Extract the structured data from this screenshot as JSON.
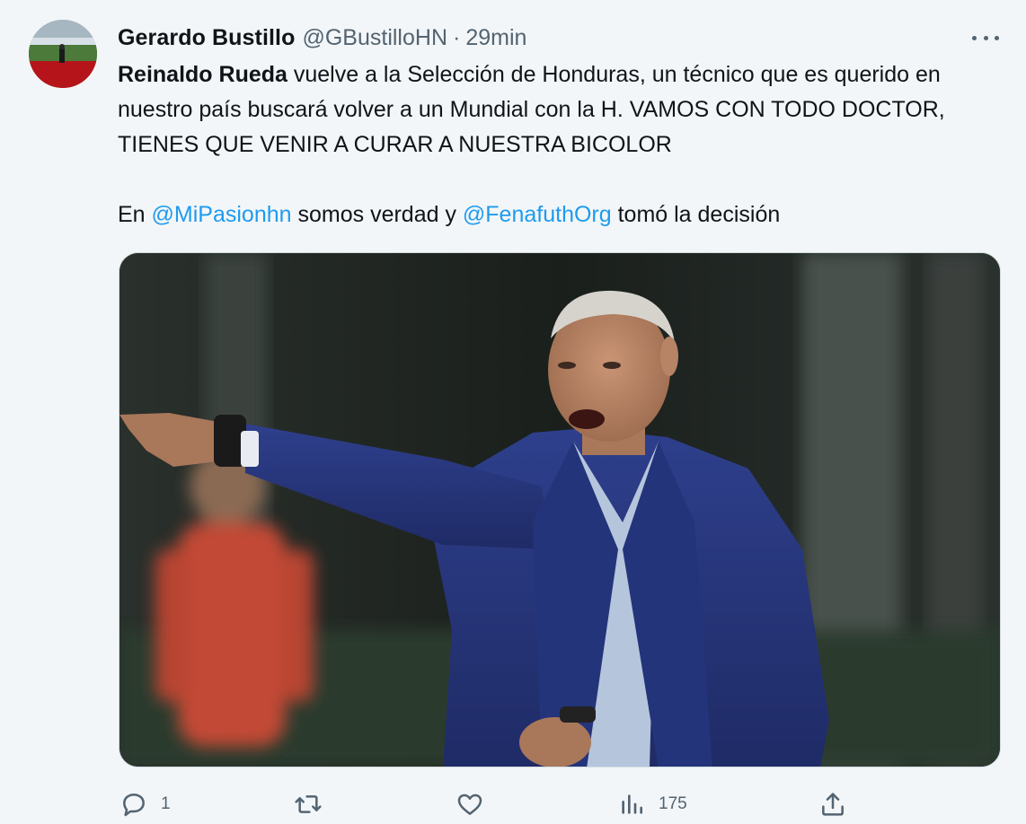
{
  "author": {
    "name": "Gerardo Bustillo",
    "handle": "@GBustilloHN",
    "separator": "·",
    "time": "29min"
  },
  "tweet": {
    "line1_bold": "Reinaldo Rueda",
    "line1_rest": " vuelve a la Selección de Honduras, un técnico que es querido en nuestro país buscará volver a un Mundial con la H. VAMOS CON TODO DOCTOR, TIENES QUE VENIR A CURAR A NUESTRA BICOLOR",
    "p2_prefix": "En ",
    "mention1": "@MiPasionhn",
    "p2_middle": " somos verdad y ",
    "mention2": "@FenafuthOrg",
    "p2_suffix": " tomó la decisión"
  },
  "actions": {
    "reply_count": "1",
    "retweet_count": "",
    "like_count": "",
    "views_count": "175"
  },
  "icons": [
    "more-icon",
    "reply-icon",
    "retweet-icon",
    "like-icon",
    "views-icon",
    "share-icon"
  ],
  "colors": {
    "link": "#1d9bf0",
    "secondary": "#536471",
    "background": "#f3f6f8"
  }
}
